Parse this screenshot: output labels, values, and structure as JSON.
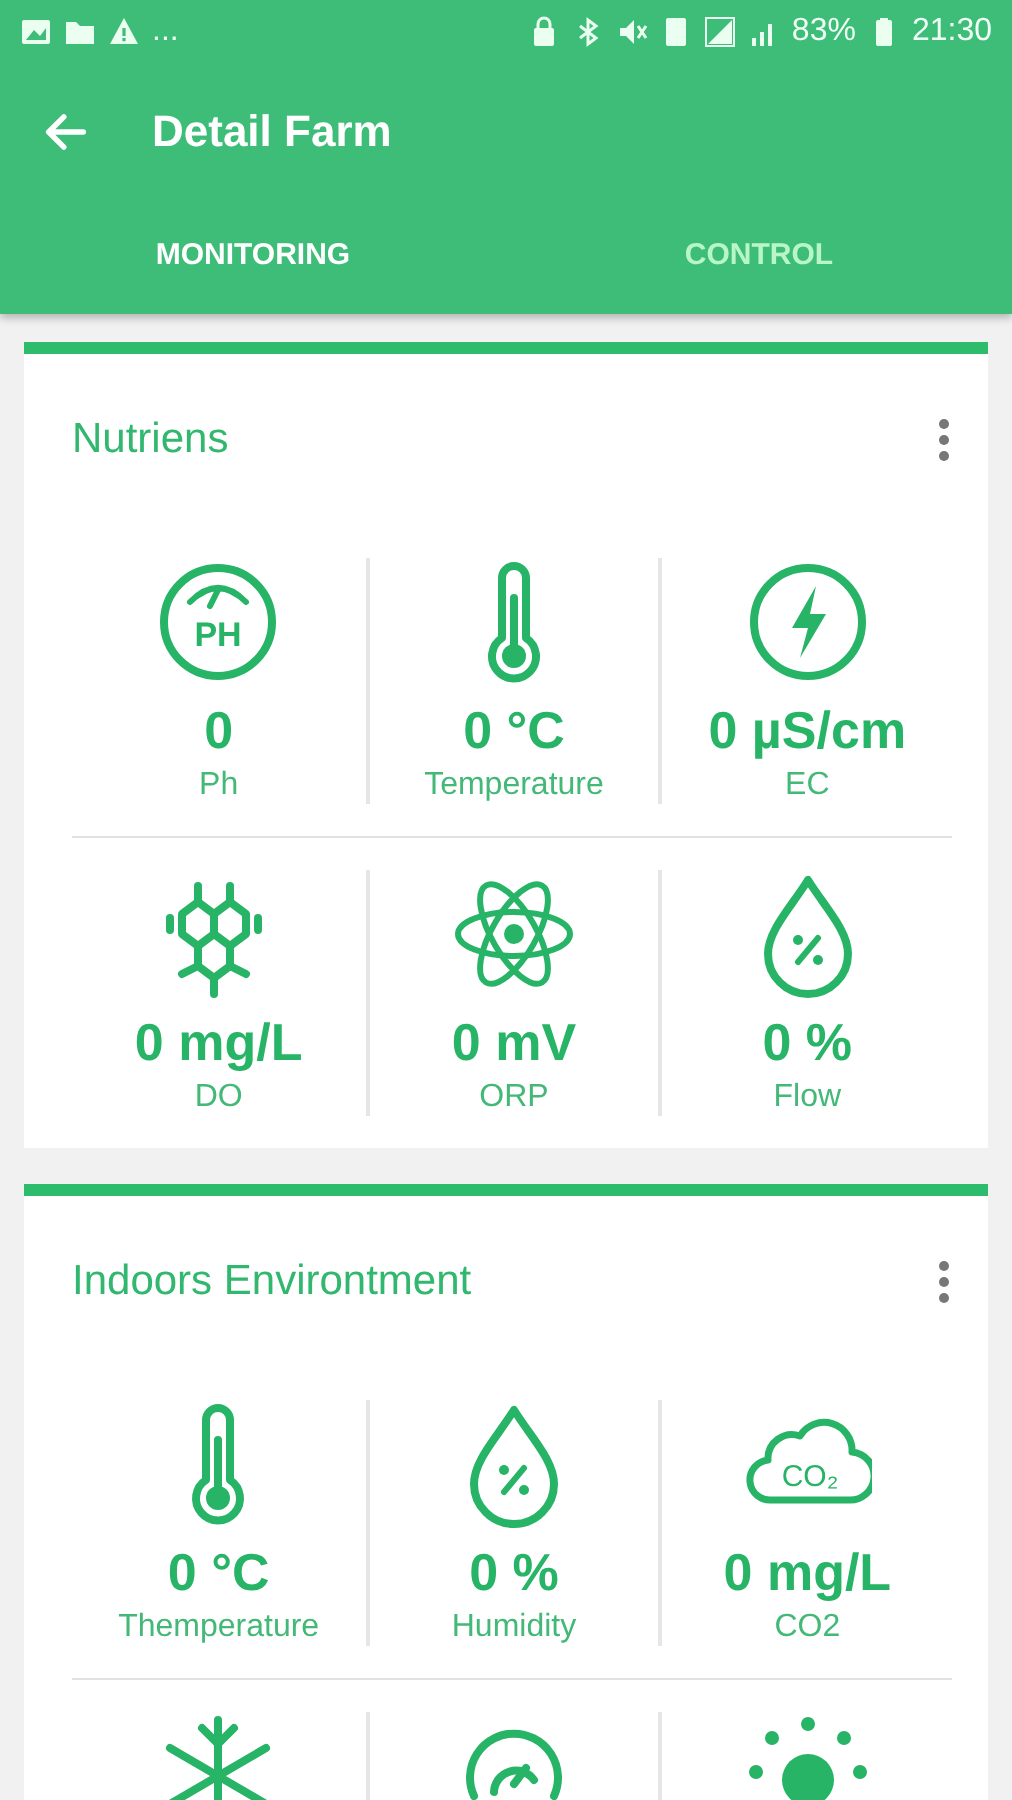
{
  "status_bar": {
    "left_text": "...",
    "battery": "83%",
    "time": "21:30"
  },
  "app_bar": {
    "title": "Detail Farm"
  },
  "tabs": [
    {
      "label": "MONITORING",
      "selected": true
    },
    {
      "label": "CONTROL",
      "selected": false
    }
  ],
  "cards": [
    {
      "title": "Nutriens",
      "rows": [
        [
          {
            "kind": "ph",
            "icon_text": "PH",
            "value": "0",
            "label": "Ph"
          },
          {
            "kind": "thermometer",
            "value": "0 °C",
            "label": "Temperature"
          },
          {
            "kind": "bolt",
            "value": "0 µS/cm",
            "label": "EC"
          }
        ],
        [
          {
            "kind": "hexagons",
            "value": "0 mg/L",
            "label": "DO"
          },
          {
            "kind": "atom",
            "value": "0 mV",
            "label": "ORP"
          },
          {
            "kind": "drop",
            "value": "0 %",
            "label": "Flow"
          }
        ]
      ]
    },
    {
      "title": "Indoors Environtment",
      "rows": [
        [
          {
            "kind": "thermometer",
            "value": "0 °C",
            "label": "Themperature"
          },
          {
            "kind": "drop",
            "value": "0 %",
            "label": "Humidity"
          },
          {
            "kind": "cloud",
            "icon_text": "CO₂",
            "value": "0 mg/L",
            "label": "CO2"
          }
        ],
        [
          {
            "kind": "snowflake"
          },
          {
            "kind": "gauge"
          },
          {
            "kind": "sun"
          }
        ]
      ]
    }
  ]
}
